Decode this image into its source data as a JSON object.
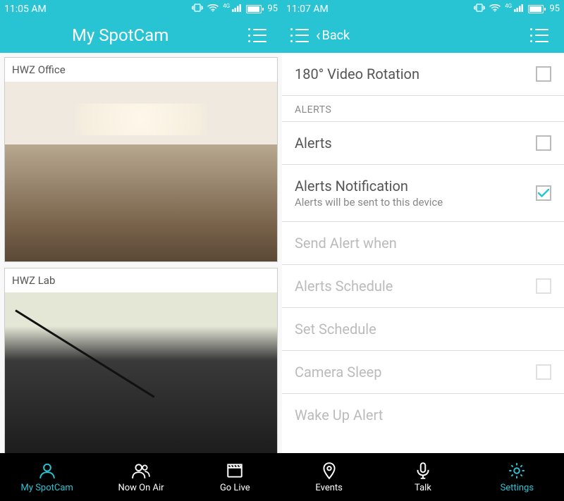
{
  "left": {
    "status": {
      "time": "11:05 AM",
      "battery": "95"
    },
    "appbar": {
      "title": "My SpotCam"
    },
    "cams": [
      {
        "label": "HWZ Office"
      },
      {
        "label": "HWZ Lab"
      }
    ]
  },
  "right": {
    "status": {
      "time": "11:07 AM",
      "battery": "95"
    },
    "appbar": {
      "back": "Back"
    },
    "rows": {
      "rotation": {
        "label": "180° Video Rotation",
        "checked": false
      },
      "alerts_header": "ALERTS",
      "alerts": {
        "label": "Alerts",
        "checked": false
      },
      "alerts_notif": {
        "label": "Alerts Notification",
        "sub": "Alerts will be sent to this device",
        "checked": true
      },
      "send_when": {
        "label": "Send Alert when"
      },
      "alerts_sched": {
        "label": "Alerts Schedule",
        "checked": false
      },
      "set_sched": {
        "label": "Set Schedule"
      },
      "cam_sleep": {
        "label": "Camera Sleep",
        "checked": false
      },
      "wake_alert": {
        "label": "Wake Up Alert"
      }
    }
  },
  "tabs": [
    {
      "label": "My SpotCam",
      "active": true
    },
    {
      "label": "Now On Air",
      "active": false
    },
    {
      "label": "Go Live",
      "active": false
    },
    {
      "label": "Events",
      "active": false
    },
    {
      "label": "Talk",
      "active": false
    },
    {
      "label": "Settings",
      "active": true
    }
  ]
}
